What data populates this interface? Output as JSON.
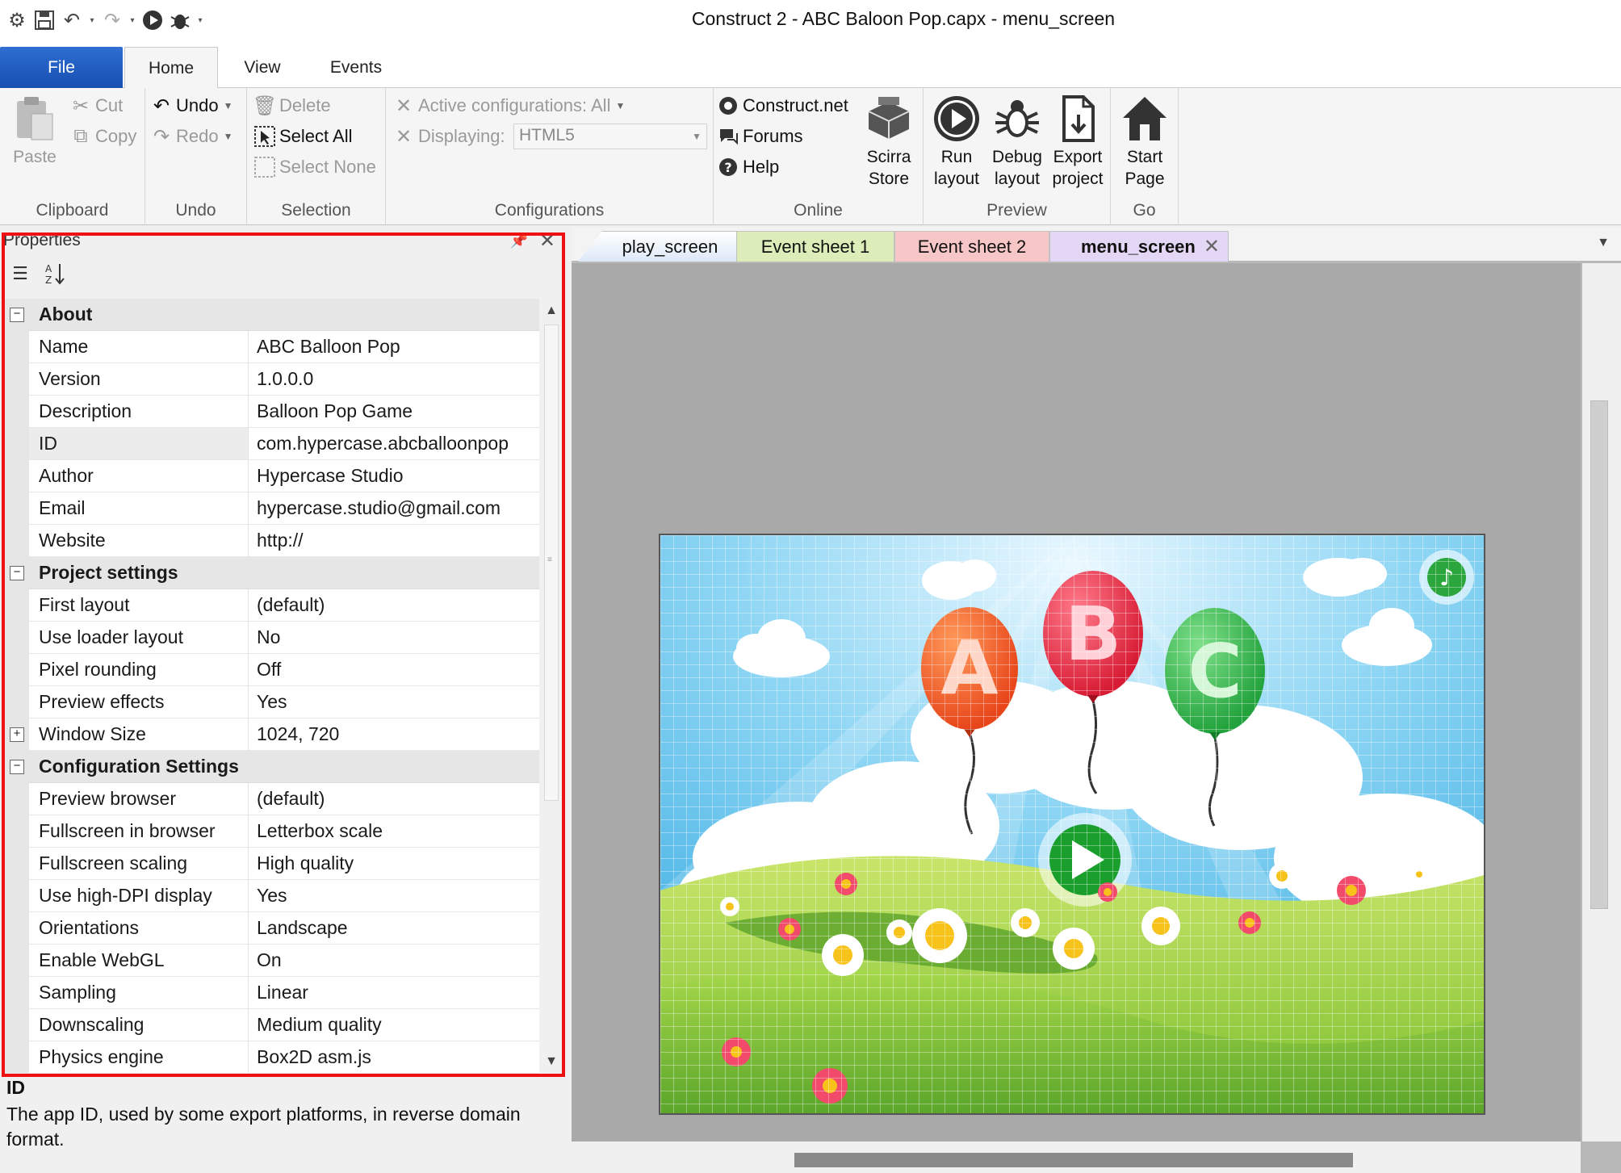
{
  "window": {
    "title": "Construct 2 - ABC Baloon Pop.capx - menu_screen"
  },
  "ribbon": {
    "tabs": {
      "file": "File",
      "home": "Home",
      "view": "View",
      "events": "Events"
    },
    "clipboard": {
      "paste": "Paste",
      "cut": "Cut",
      "copy": "Copy",
      "label": "Clipboard"
    },
    "undo": {
      "undo": "Undo",
      "redo": "Redo",
      "label": "Undo"
    },
    "selection": {
      "delete": "Delete",
      "select_all": "Select All",
      "select_none": "Select None",
      "label": "Selection"
    },
    "configurations": {
      "active": "Active configurations: All",
      "displaying_label": "Displaying:",
      "displaying_value": "HTML5",
      "label": "Configurations"
    },
    "online": {
      "construct_net": "Construct.net",
      "forums": "Forums",
      "help": "Help",
      "store_line1": "Scirra",
      "store_line2": "Store",
      "label": "Online"
    },
    "preview": {
      "run_line1": "Run",
      "run_line2": "layout",
      "debug_line1": "Debug",
      "debug_line2": "layout",
      "export_line1": "Export",
      "export_line2": "project",
      "label": "Preview"
    },
    "go": {
      "start_line1": "Start",
      "start_line2": "Page",
      "label": "Go"
    }
  },
  "properties": {
    "title": "Properties",
    "rows": [
      {
        "type": "category",
        "key": "About",
        "expander": "−"
      },
      {
        "type": "prop",
        "key": "Name",
        "value": "ABC Balloon Pop"
      },
      {
        "type": "prop",
        "key": "Version",
        "value": "1.0.0.0"
      },
      {
        "type": "prop",
        "key": "Description",
        "value": "Balloon Pop Game"
      },
      {
        "type": "prop",
        "key": "ID",
        "value": "com.hypercase.abcballoonpop",
        "selected": true
      },
      {
        "type": "prop",
        "key": "Author",
        "value": "Hypercase Studio"
      },
      {
        "type": "prop",
        "key": "Email",
        "value": "hypercase.studio@gmail.com"
      },
      {
        "type": "prop",
        "key": "Website",
        "value": "http://"
      },
      {
        "type": "category",
        "key": "Project settings",
        "expander": "−"
      },
      {
        "type": "prop",
        "key": "First layout",
        "value": "(default)"
      },
      {
        "type": "prop",
        "key": "Use loader layout",
        "value": "No"
      },
      {
        "type": "prop",
        "key": "Pixel rounding",
        "value": "Off"
      },
      {
        "type": "prop",
        "key": "Preview effects",
        "value": "Yes"
      },
      {
        "type": "prop",
        "key": "Window Size",
        "value": "1024, 720",
        "expander": "+"
      },
      {
        "type": "category",
        "key": "Configuration Settings",
        "expander": "−"
      },
      {
        "type": "prop",
        "key": "Preview browser",
        "value": "(default)"
      },
      {
        "type": "prop",
        "key": "Fullscreen in browser",
        "value": "Letterbox scale"
      },
      {
        "type": "prop",
        "key": "Fullscreen scaling",
        "value": "High quality"
      },
      {
        "type": "prop",
        "key": "Use high-DPI display",
        "value": "Yes"
      },
      {
        "type": "prop",
        "key": "Orientations",
        "value": "Landscape"
      },
      {
        "type": "prop",
        "key": "Enable WebGL",
        "value": "On"
      },
      {
        "type": "prop",
        "key": "Sampling",
        "value": "Linear"
      },
      {
        "type": "prop",
        "key": "Downscaling",
        "value": "Medium quality"
      },
      {
        "type": "prop",
        "key": "Physics engine",
        "value": "Box2D asm.js"
      }
    ],
    "description": {
      "title": "ID",
      "body": "The app ID, used by some export platforms, in reverse domain format."
    }
  },
  "document_tabs": [
    {
      "label": "play_screen"
    },
    {
      "label": "Event sheet 1"
    },
    {
      "label": "Event sheet 2"
    },
    {
      "label": "menu_screen",
      "active": true
    }
  ],
  "scene": {
    "balloons": [
      "A",
      "B",
      "C"
    ],
    "colors": {
      "sky": "#5ec2ec",
      "grass": "#8cc63f",
      "balloon_a": "#f15a24",
      "balloon_b": "#e8233a",
      "balloon_c": "#2fb34a",
      "play_button": "#1a9e2c"
    }
  },
  "icons": {
    "qat": [
      "settings-icon",
      "save-icon",
      "undo-icon",
      "redo-icon",
      "run-icon",
      "debug-icon"
    ],
    "ribbon": [
      "paste-icon",
      "cut-icon",
      "copy-icon",
      "delete-icon",
      "select-all-icon",
      "globe-icon",
      "forums-icon",
      "help-icon",
      "store-icon",
      "play-icon",
      "bug-icon",
      "export-icon",
      "home-icon"
    ]
  }
}
